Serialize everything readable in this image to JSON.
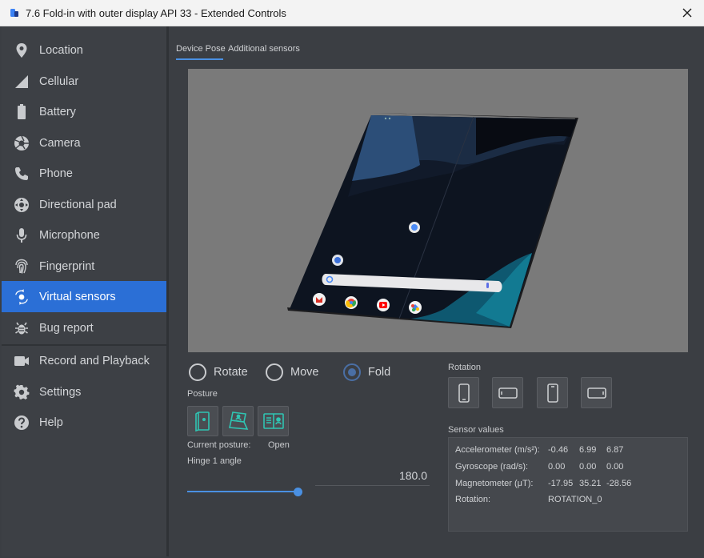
{
  "window": {
    "title": "7.6  Fold-in with outer display API 33 - Extended Controls"
  },
  "sidebar": {
    "items": [
      {
        "label": "Location",
        "icon": "location-pin-icon"
      },
      {
        "label": "Cellular",
        "icon": "signal-icon"
      },
      {
        "label": "Battery",
        "icon": "battery-icon"
      },
      {
        "label": "Camera",
        "icon": "camera-aperture-icon"
      },
      {
        "label": "Phone",
        "icon": "phone-icon"
      },
      {
        "label": "Directional pad",
        "icon": "dpad-icon"
      },
      {
        "label": "Microphone",
        "icon": "microphone-icon"
      },
      {
        "label": "Fingerprint",
        "icon": "fingerprint-icon"
      },
      {
        "label": "Virtual sensors",
        "icon": "virtual-sensors-icon",
        "active": true
      },
      {
        "label": "Bug report",
        "icon": "bug-icon"
      },
      {
        "label": "Record and Playback",
        "icon": "video-camera-icon"
      },
      {
        "label": "Settings",
        "icon": "gear-icon"
      },
      {
        "label": "Help",
        "icon": "help-icon"
      }
    ]
  },
  "tabs": [
    {
      "label": "Device Pose",
      "active": true
    },
    {
      "label": "Additional sensors",
      "active": false
    }
  ],
  "mode": {
    "options": [
      "Rotate",
      "Move",
      "Fold"
    ],
    "selected": "Fold"
  },
  "posture": {
    "label": "Posture",
    "current_label": "Current posture:",
    "current_value": "Open"
  },
  "hinge": {
    "label": "Hinge 1 angle",
    "value": "180.0",
    "fraction": 1.0
  },
  "rotation": {
    "label": "Rotation"
  },
  "sensor_values": {
    "label": "Sensor values",
    "rows": [
      {
        "name": "Accelerometer (m/s²):",
        "values": [
          "-0.46",
          "6.99",
          "6.87"
        ]
      },
      {
        "name": "Gyroscope (rad/s):",
        "values": [
          "0.00",
          "0.00",
          "0.00"
        ]
      },
      {
        "name": "Magnetometer (μT):",
        "values": [
          "-17.95",
          "35.21",
          "-28.56"
        ]
      },
      {
        "name": "Rotation:",
        "values": [
          "ROTATION_0"
        ]
      }
    ]
  },
  "colors": {
    "accent": "#2b6fd6",
    "slider": "#4a90e2",
    "icon_teal": "#2fc4b2"
  }
}
